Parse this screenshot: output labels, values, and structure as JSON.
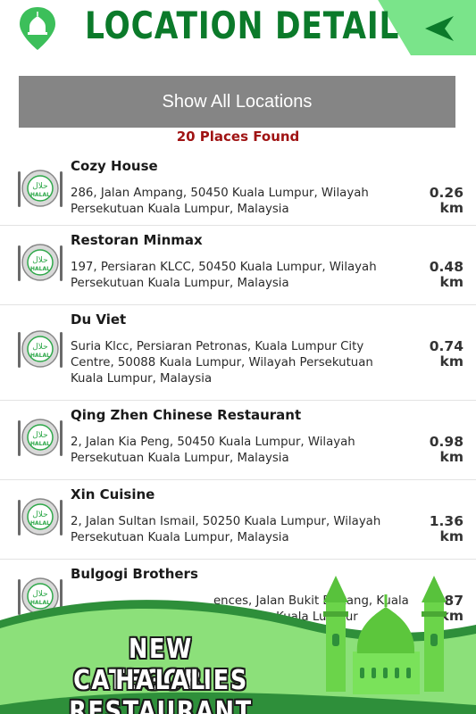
{
  "header": {
    "title": "LOCATION DETAIL",
    "colors": {
      "title": "#0b7a2a",
      "band": "#7ae48a",
      "pin": "#3cbf5a"
    }
  },
  "show_all_label": "Show All Locations",
  "found_label": "20 Places Found",
  "places": [
    {
      "name": "Cozy House",
      "address": "286, Jalan Ampang, 50450 Kuala Lumpur, Wilayah Persekutuan Kuala Lumpur, Malaysia",
      "distance": "0.26",
      "unit": "km"
    },
    {
      "name": "Restoran Minmax",
      "address": "197, Persiaran KLCC, 50450 Kuala Lumpur, Wilayah Persekutuan Kuala Lumpur, Malaysia",
      "distance": "0.48",
      "unit": "km"
    },
    {
      "name": "Du Viet",
      "address": "Suria Klcc, Persiaran Petronas, Kuala Lumpur City Centre, 50088 Kuala Lumpur, Wilayah Persekutuan Kuala Lumpur, Malaysia",
      "distance": "0.74",
      "unit": "km"
    },
    {
      "name": "Qing Zhen Chinese Restaurant",
      "address": "2, Jalan Kia Peng, 50450 Kuala Lumpur, Wilayah Persekutuan Kuala Lumpur, Malaysia",
      "distance": "0.98",
      "unit": "km"
    },
    {
      "name": "Xin Cuisine",
      "address": "2, Jalan Sultan Ismail, 50250 Kuala Lumpur, Wilayah Persekutuan Kuala Lumpur, Malaysia",
      "distance": "1.36",
      "unit": "km"
    },
    {
      "name": "Bulgogi Brothers",
      "address": "ences, Jalan Bukit Bintang, Kuala ",
      "address2": "kutuan Kuala Lumpur",
      "distance": "87",
      "unit": "km"
    }
  ],
  "halal_badge": {
    "arabic": "حلال",
    "latin": "HALAL"
  },
  "banner": {
    "line1": "NEW CATEGORIES",
    "line2": "HALAL RESTAURANT"
  }
}
